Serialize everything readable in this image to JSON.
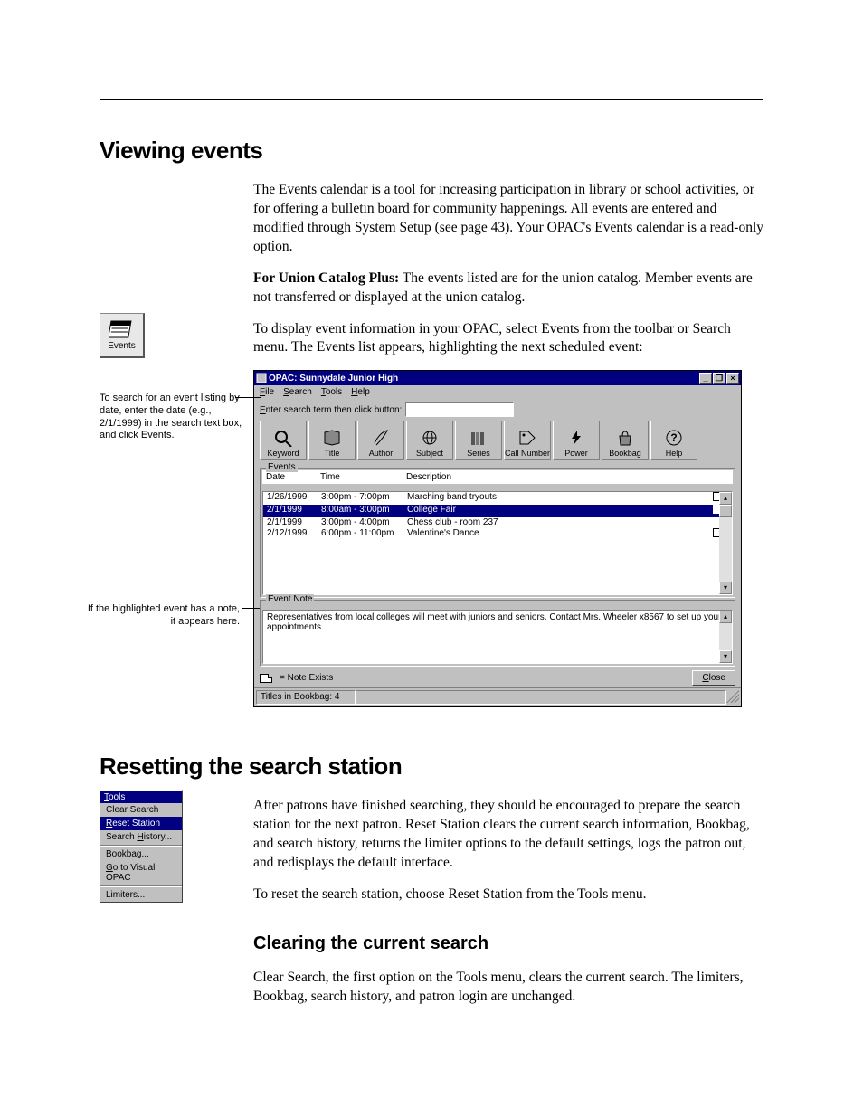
{
  "section1": {
    "heading": "Viewing events",
    "para1": "The Events calendar is a tool for increasing participation in library or school activities, or for offering a bulletin board for community happenings. All events are entered and modified through System Setup (see page 43). Your OPAC's Events calendar is a read-only option.",
    "union_prefix": "For Union Catalog Plus:",
    "union_text": "  The events listed are for the union catalog. Member events are not transferred or displayed at the union catalog.",
    "para3": "To display event information in your OPAC, select Events from the toolbar or Search menu. The Events list appears, highlighting the next scheduled event:",
    "events_icon_label": "Events",
    "margin_note1": "To search for an event listing by date, enter the date (e.g., 2/1/1999) in the search text box, and click Events.",
    "margin_note2": "If the highlighted event has a note, it appears here."
  },
  "screenshot": {
    "title": "OPAC: Sunnydale Junior High",
    "menus": [
      "File",
      "Search",
      "Tools",
      "Help"
    ],
    "search_label": "Enter search term then click button:",
    "toolbar": [
      "Keyword",
      "Title",
      "Author",
      "Subject",
      "Series",
      "Call Number",
      "Power",
      "Bookbag",
      "Help"
    ],
    "events_group": "Events",
    "headers": {
      "date": "Date",
      "time": "Time",
      "desc": "Description"
    },
    "rows": [
      {
        "date": "1/26/1999",
        "time": "3:00pm - 7:00pm",
        "desc": "Marching band tryouts",
        "note": true
      },
      {
        "date": "2/1/1999",
        "time": "8:00am - 3:00pm",
        "desc": "College Fair",
        "note": true,
        "selected": true
      },
      {
        "date": "2/1/1999",
        "time": "3:00pm - 4:00pm",
        "desc": "Chess club - room 237",
        "note": false
      },
      {
        "date": "2/12/1999",
        "time": "6:00pm - 11:00pm",
        "desc": "Valentine's Dance",
        "note": true
      }
    ],
    "event_note_group": "Event Note",
    "event_note_text": "Representatives from local colleges will meet with juniors and seniors. Contact Mrs. Wheeler x8567 to set up your appointments.",
    "note_exists_label": " = Note Exists",
    "close_btn": "Close",
    "statusbar": "Titles in Bookbag:  4"
  },
  "section2": {
    "heading": "Resetting the search station",
    "para1": "After patrons have finished searching, they should be encouraged to prepare the search station for the next patron. Reset Station clears the current search information, Bookbag, and search history, returns the limiter options to the default settings, logs the patron out, and redisplays the default interface.",
    "para2": "To reset the search station, choose Reset Station from the Tools menu.",
    "tools_title": "Tools",
    "tools_items": [
      "Clear Search",
      "Reset Station",
      "Search History...",
      "Bookbag...",
      "Go to Visual OPAC",
      "Limiters..."
    ]
  },
  "section3": {
    "heading": "Clearing the current search",
    "para1": "Clear Search, the first option on the Tools menu, clears the current search. The limiters, Bookbag, search history, and patron login are unchanged."
  }
}
